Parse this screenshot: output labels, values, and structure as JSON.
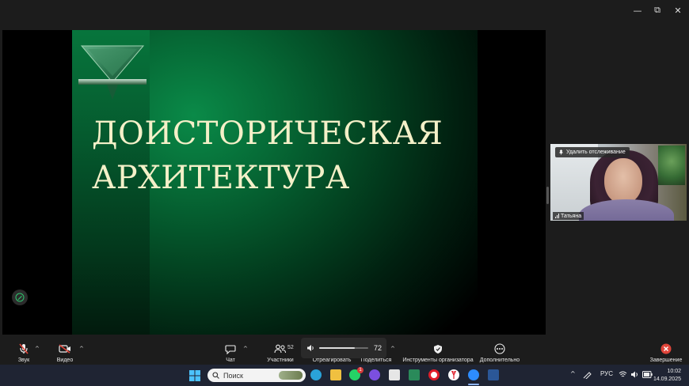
{
  "window": {
    "minimize_icon": "—",
    "restore_icon": "⧉",
    "close_icon": "✕"
  },
  "slide": {
    "title_line1": "ДОИСТОРИЧЕСКАЯ",
    "title_line2": "АРХИТЕКТУРА",
    "title_color": "#f4f0c8",
    "accent": "#0a8a48"
  },
  "video": {
    "remove_pin_label": "Удалить отслеживание",
    "participant_name": "Татьяна"
  },
  "toolbar": {
    "audio_label": "Звук",
    "video_label": "Видео",
    "chat_label": "Чат",
    "participants_label": "Участники",
    "participants_count": "52",
    "react_label": "Отреагировать",
    "share_label": "Поделиться",
    "host_tools_label": "Инструменты организатора",
    "more_label": "Дополнительно",
    "end_label": "Завершение",
    "volume_value": "72",
    "volume_fraction": 0.72
  },
  "taskbar": {
    "search_placeholder": "Поиск",
    "language": "РУС",
    "time": "10:02",
    "date": "14.09.2025",
    "badge_count": "1"
  }
}
